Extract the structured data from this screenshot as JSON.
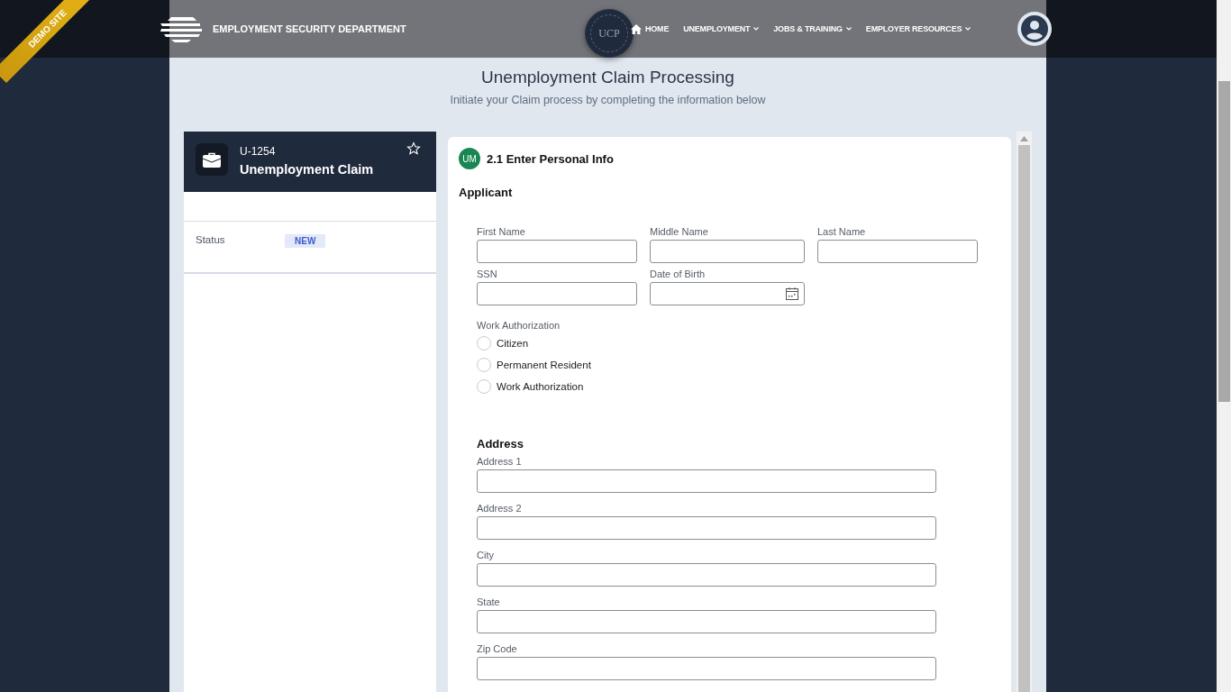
{
  "ribbon": "DEMO SITE",
  "header": {
    "brand": "EMPLOYMENT SECURITY DEPARTMENT",
    "seal": "UCP",
    "nav": [
      {
        "label": "HOME",
        "kind": "home"
      },
      {
        "label": "UNEMPLOYMENT",
        "kind": "dropdown"
      },
      {
        "label": "JOBS & TRAINING",
        "kind": "dropdown"
      },
      {
        "label": "EMPLOYER RESOURCES",
        "kind": "dropdown"
      }
    ]
  },
  "page": {
    "title": "Unemployment Claim Processing",
    "subtitle": "Initiate your Claim process by completing the information below"
  },
  "case_card": {
    "id": "U-1254",
    "title": "Unemployment Claim",
    "starred": false,
    "status_label": "Status",
    "status": "NEW"
  },
  "form": {
    "step_badge": "UM",
    "step_title": "2.1 Enter Personal Info",
    "section": "Applicant",
    "name_fields": [
      {
        "label": "First Name"
      },
      {
        "label": "Middle Name"
      },
      {
        "label": "Last Name"
      }
    ],
    "id_fields": [
      {
        "label": "SSN"
      },
      {
        "label": "Date of Birth",
        "kind": "date"
      }
    ],
    "work_authorization": {
      "label": "Work Authorization",
      "options": [
        {
          "label": "Citizen",
          "selected": false
        },
        {
          "label": "Permanent Resident",
          "selected": false
        },
        {
          "label": "Work Authorization",
          "selected": false
        }
      ]
    },
    "address": {
      "title": "Address",
      "fields": [
        {
          "label": "Address 1"
        },
        {
          "label": "Address 2"
        },
        {
          "label": "City"
        },
        {
          "label": "State"
        },
        {
          "label": "Zip Code"
        }
      ]
    }
  }
}
